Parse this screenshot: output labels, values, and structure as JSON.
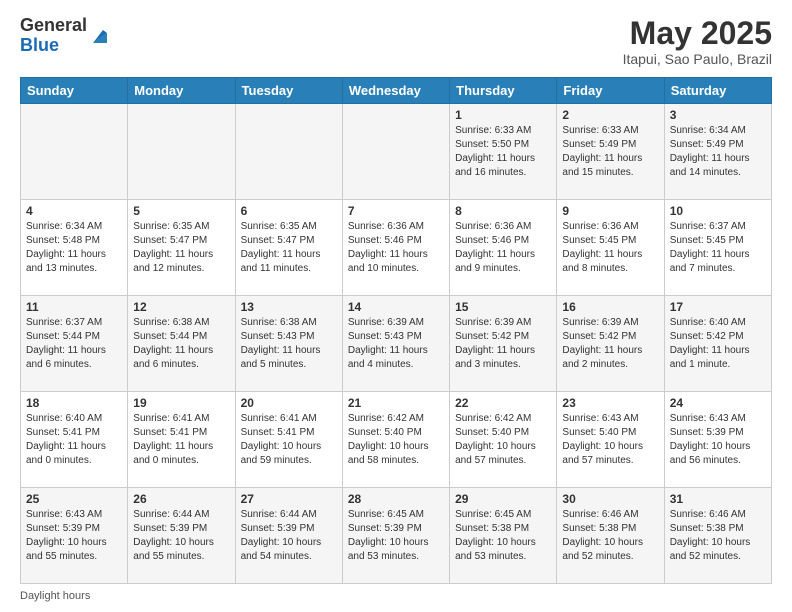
{
  "header": {
    "logo_line1": "General",
    "logo_line2": "Blue",
    "title": "May 2025",
    "location": "Itapui, Sao Paulo, Brazil"
  },
  "days_of_week": [
    "Sunday",
    "Monday",
    "Tuesday",
    "Wednesday",
    "Thursday",
    "Friday",
    "Saturday"
  ],
  "weeks": [
    [
      {
        "day": "",
        "info": ""
      },
      {
        "day": "",
        "info": ""
      },
      {
        "day": "",
        "info": ""
      },
      {
        "day": "",
        "info": ""
      },
      {
        "day": "1",
        "info": "Sunrise: 6:33 AM\nSunset: 5:50 PM\nDaylight: 11 hours and 16 minutes."
      },
      {
        "day": "2",
        "info": "Sunrise: 6:33 AM\nSunset: 5:49 PM\nDaylight: 11 hours and 15 minutes."
      },
      {
        "day": "3",
        "info": "Sunrise: 6:34 AM\nSunset: 5:49 PM\nDaylight: 11 hours and 14 minutes."
      }
    ],
    [
      {
        "day": "4",
        "info": "Sunrise: 6:34 AM\nSunset: 5:48 PM\nDaylight: 11 hours and 13 minutes."
      },
      {
        "day": "5",
        "info": "Sunrise: 6:35 AM\nSunset: 5:47 PM\nDaylight: 11 hours and 12 minutes."
      },
      {
        "day": "6",
        "info": "Sunrise: 6:35 AM\nSunset: 5:47 PM\nDaylight: 11 hours and 11 minutes."
      },
      {
        "day": "7",
        "info": "Sunrise: 6:36 AM\nSunset: 5:46 PM\nDaylight: 11 hours and 10 minutes."
      },
      {
        "day": "8",
        "info": "Sunrise: 6:36 AM\nSunset: 5:46 PM\nDaylight: 11 hours and 9 minutes."
      },
      {
        "day": "9",
        "info": "Sunrise: 6:36 AM\nSunset: 5:45 PM\nDaylight: 11 hours and 8 minutes."
      },
      {
        "day": "10",
        "info": "Sunrise: 6:37 AM\nSunset: 5:45 PM\nDaylight: 11 hours and 7 minutes."
      }
    ],
    [
      {
        "day": "11",
        "info": "Sunrise: 6:37 AM\nSunset: 5:44 PM\nDaylight: 11 hours and 6 minutes."
      },
      {
        "day": "12",
        "info": "Sunrise: 6:38 AM\nSunset: 5:44 PM\nDaylight: 11 hours and 6 minutes."
      },
      {
        "day": "13",
        "info": "Sunrise: 6:38 AM\nSunset: 5:43 PM\nDaylight: 11 hours and 5 minutes."
      },
      {
        "day": "14",
        "info": "Sunrise: 6:39 AM\nSunset: 5:43 PM\nDaylight: 11 hours and 4 minutes."
      },
      {
        "day": "15",
        "info": "Sunrise: 6:39 AM\nSunset: 5:42 PM\nDaylight: 11 hours and 3 minutes."
      },
      {
        "day": "16",
        "info": "Sunrise: 6:39 AM\nSunset: 5:42 PM\nDaylight: 11 hours and 2 minutes."
      },
      {
        "day": "17",
        "info": "Sunrise: 6:40 AM\nSunset: 5:42 PM\nDaylight: 11 hours and 1 minute."
      }
    ],
    [
      {
        "day": "18",
        "info": "Sunrise: 6:40 AM\nSunset: 5:41 PM\nDaylight: 11 hours and 0 minutes."
      },
      {
        "day": "19",
        "info": "Sunrise: 6:41 AM\nSunset: 5:41 PM\nDaylight: 11 hours and 0 minutes."
      },
      {
        "day": "20",
        "info": "Sunrise: 6:41 AM\nSunset: 5:41 PM\nDaylight: 10 hours and 59 minutes."
      },
      {
        "day": "21",
        "info": "Sunrise: 6:42 AM\nSunset: 5:40 PM\nDaylight: 10 hours and 58 minutes."
      },
      {
        "day": "22",
        "info": "Sunrise: 6:42 AM\nSunset: 5:40 PM\nDaylight: 10 hours and 57 minutes."
      },
      {
        "day": "23",
        "info": "Sunrise: 6:43 AM\nSunset: 5:40 PM\nDaylight: 10 hours and 57 minutes."
      },
      {
        "day": "24",
        "info": "Sunrise: 6:43 AM\nSunset: 5:39 PM\nDaylight: 10 hours and 56 minutes."
      }
    ],
    [
      {
        "day": "25",
        "info": "Sunrise: 6:43 AM\nSunset: 5:39 PM\nDaylight: 10 hours and 55 minutes."
      },
      {
        "day": "26",
        "info": "Sunrise: 6:44 AM\nSunset: 5:39 PM\nDaylight: 10 hours and 55 minutes."
      },
      {
        "day": "27",
        "info": "Sunrise: 6:44 AM\nSunset: 5:39 PM\nDaylight: 10 hours and 54 minutes."
      },
      {
        "day": "28",
        "info": "Sunrise: 6:45 AM\nSunset: 5:39 PM\nDaylight: 10 hours and 53 minutes."
      },
      {
        "day": "29",
        "info": "Sunrise: 6:45 AM\nSunset: 5:38 PM\nDaylight: 10 hours and 53 minutes."
      },
      {
        "day": "30",
        "info": "Sunrise: 6:46 AM\nSunset: 5:38 PM\nDaylight: 10 hours and 52 minutes."
      },
      {
        "day": "31",
        "info": "Sunrise: 6:46 AM\nSunset: 5:38 PM\nDaylight: 10 hours and 52 minutes."
      }
    ]
  ],
  "footer": {
    "label": "Daylight hours"
  }
}
